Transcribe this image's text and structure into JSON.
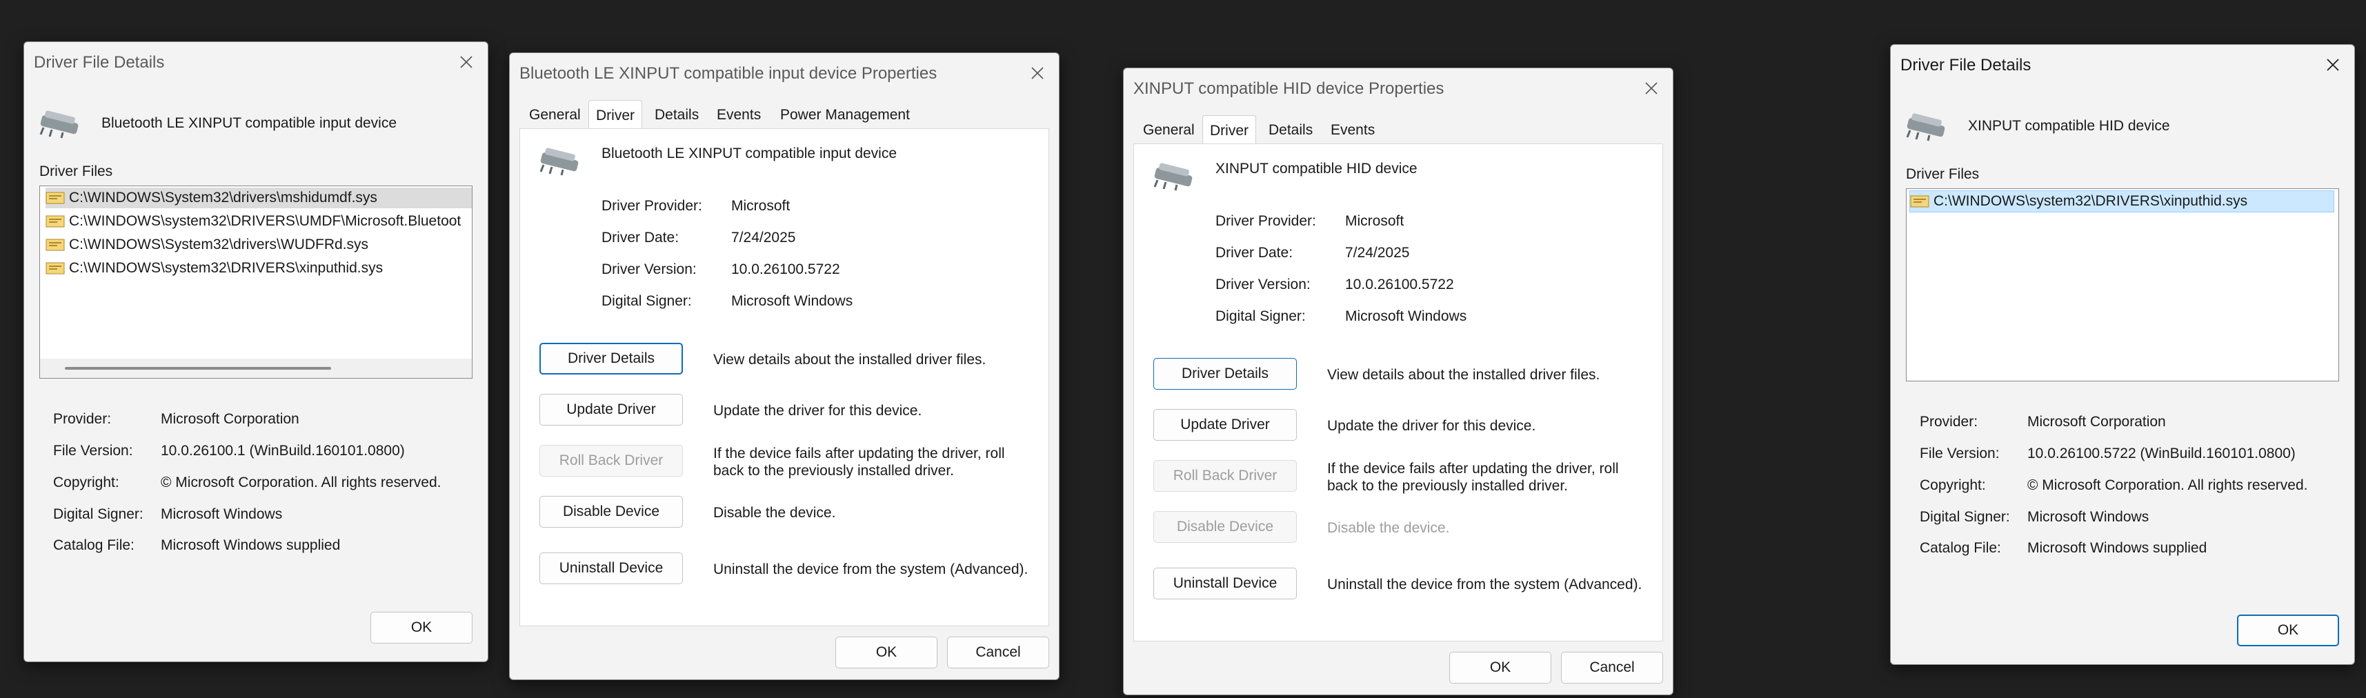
{
  "win1": {
    "title": "Driver File Details",
    "device_name": "Bluetooth LE XINPUT compatible input device",
    "files_label": "Driver Files",
    "files": [
      "C:\\WINDOWS\\System32\\drivers\\mshidumdf.sys",
      "C:\\WINDOWS\\system32\\DRIVERS\\UMDF\\Microsoft.Bluetoot",
      "C:\\WINDOWS\\System32\\drivers\\WUDFRd.sys",
      "C:\\WINDOWS\\system32\\DRIVERS\\xinputhid.sys"
    ],
    "info": [
      {
        "label": "Provider:",
        "value": "Microsoft Corporation"
      },
      {
        "label": "File Version:",
        "value": "10.0.26100.1 (WinBuild.160101.0800)"
      },
      {
        "label": "Copyright:",
        "value": "© Microsoft Corporation. All rights reserved."
      },
      {
        "label": "Digital Signer:",
        "value": "Microsoft Windows"
      },
      {
        "label": "Catalog File:",
        "value": "Microsoft Windows supplied"
      }
    ],
    "ok_label": "OK"
  },
  "win2": {
    "title": "Bluetooth LE XINPUT compatible input device Properties",
    "tabs": [
      "General",
      "Driver",
      "Details",
      "Events",
      "Power Management"
    ],
    "device_name": "Bluetooth LE XINPUT compatible input device",
    "info": [
      {
        "label": "Driver Provider:",
        "value": "Microsoft"
      },
      {
        "label": "Driver Date:",
        "value": "7/24/2025"
      },
      {
        "label": "Driver Version:",
        "value": "10.0.26100.5722"
      },
      {
        "label": "Digital Signer:",
        "value": "Microsoft Windows"
      }
    ],
    "actions": [
      {
        "label": "Driver Details",
        "desc": "View details about the installed driver files."
      },
      {
        "label": "Update Driver",
        "desc": "Update the driver for this device."
      },
      {
        "label": "Roll Back Driver",
        "desc1": "If the device fails after updating the driver, roll",
        "desc2": "back to the previously installed driver."
      },
      {
        "label": "Disable Device",
        "desc": "Disable the device."
      },
      {
        "label": "Uninstall Device",
        "desc": "Uninstall the device from the system (Advanced)."
      }
    ],
    "ok_label": "OK",
    "cancel_label": "Cancel"
  },
  "win3": {
    "title": "XINPUT compatible HID device Properties",
    "tabs": [
      "General",
      "Driver",
      "Details",
      "Events"
    ],
    "device_name": "XINPUT compatible HID device",
    "info": [
      {
        "label": "Driver Provider:",
        "value": "Microsoft"
      },
      {
        "label": "Driver Date:",
        "value": "7/24/2025"
      },
      {
        "label": "Driver Version:",
        "value": "10.0.26100.5722"
      },
      {
        "label": "Digital Signer:",
        "value": "Microsoft Windows"
      }
    ],
    "actions": [
      {
        "label": "Driver Details",
        "desc": "View details about the installed driver files."
      },
      {
        "label": "Update Driver",
        "desc": "Update the driver for this device."
      },
      {
        "label": "Roll Back Driver",
        "desc1": "If the device fails after updating the driver, roll",
        "desc2": "back to the previously installed driver."
      },
      {
        "label": "Disable Device",
        "desc": "Disable the device."
      },
      {
        "label": "Uninstall Device",
        "desc": "Uninstall the device from the system (Advanced)."
      }
    ],
    "ok_label": "OK",
    "cancel_label": "Cancel"
  },
  "win4": {
    "title": "Driver File Details",
    "device_name": "XINPUT compatible HID device",
    "files_label": "Driver Files",
    "files": [
      "C:\\WINDOWS\\system32\\DRIVERS\\xinputhid.sys"
    ],
    "info": [
      {
        "label": "Provider:",
        "value": "Microsoft Corporation"
      },
      {
        "label": "File Version:",
        "value": "10.0.26100.5722 (WinBuild.160101.0800)"
      },
      {
        "label": "Copyright:",
        "value": "© Microsoft Corporation. All rights reserved."
      },
      {
        "label": "Digital Signer:",
        "value": "Microsoft Windows"
      },
      {
        "label": "Catalog File:",
        "value": "Microsoft Windows supplied"
      }
    ],
    "ok_label": "OK"
  },
  "icons": {
    "device": "gamepad-icon",
    "file": "driver-file-icon",
    "close": "close-icon"
  },
  "colors": {
    "desktop": "#202020",
    "window": "#f3f3f3",
    "accent": "#0f6cbd",
    "selection": "#cce8ff",
    "disabled_text": "#9d9d9d"
  }
}
